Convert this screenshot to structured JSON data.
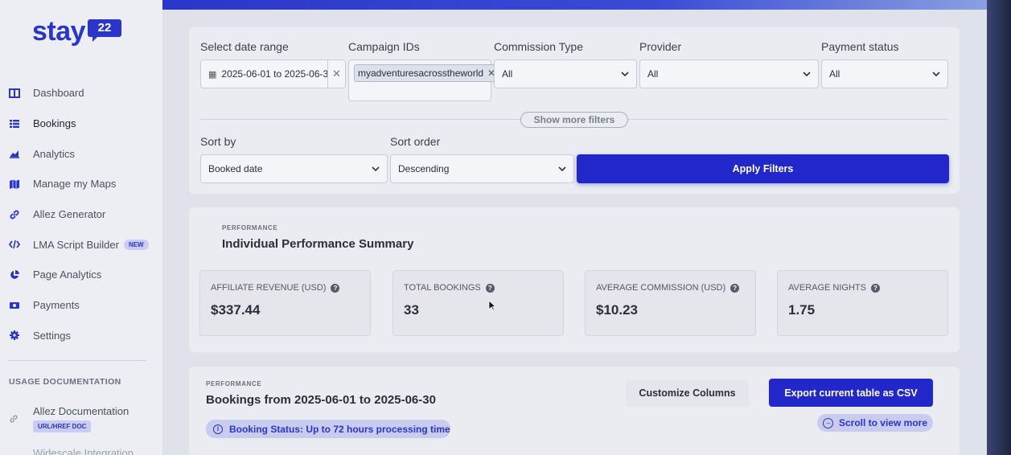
{
  "brand": {
    "logo_text": "stay",
    "logo_badge": "22",
    "accent": "#2a36c9"
  },
  "sidebar": {
    "items": [
      {
        "label": "Dashboard",
        "icon": "dashboard-icon"
      },
      {
        "label": "Bookings",
        "icon": "list-icon"
      },
      {
        "label": "Analytics",
        "icon": "chart-icon"
      },
      {
        "label": "Manage my Maps",
        "icon": "map-icon"
      },
      {
        "label": "Allez Generator",
        "icon": "link-icon"
      },
      {
        "label": "LMA Script Builder",
        "icon": "code-icon",
        "badge": "NEW"
      },
      {
        "label": "Page Analytics",
        "icon": "pie-icon"
      },
      {
        "label": "Payments",
        "icon": "money-icon"
      },
      {
        "label": "Settings",
        "icon": "gear-icon"
      }
    ],
    "doc_heading": "USAGE DOCUMENTATION",
    "doc_items": [
      {
        "title": "Allez Documentation",
        "badge": "URL/HREF DOC"
      }
    ],
    "doc_cut_off": "Widescale Integration"
  },
  "filters": {
    "date_range": {
      "label": "Select date range",
      "value": "2025-06-01 to 2025-06-3"
    },
    "campaign_ids": {
      "label": "Campaign IDs",
      "tag": "myadventuresacrosstheworld"
    },
    "commission_type": {
      "label": "Commission Type",
      "value": "All"
    },
    "provider": {
      "label": "Provider",
      "value": "All"
    },
    "payment_status": {
      "label": "Payment status",
      "value": "All"
    },
    "show_more": "Show more filters",
    "sort_by": {
      "label": "Sort by",
      "value": "Booked date"
    },
    "sort_order": {
      "label": "Sort order",
      "value": "Descending"
    },
    "apply": "Apply Filters"
  },
  "summary": {
    "kicker": "PERFORMANCE",
    "title": "Individual Performance Summary",
    "stats": [
      {
        "label": "AFFILIATE REVENUE (USD)",
        "value": "$337.44"
      },
      {
        "label": "TOTAL BOOKINGS",
        "value": "33"
      },
      {
        "label": "AVERAGE COMMISSION (USD)",
        "value": "$10.23"
      },
      {
        "label": "AVERAGE NIGHTS",
        "value": "1.75"
      }
    ]
  },
  "bookings": {
    "kicker": "PERFORMANCE",
    "title": "Bookings from 2025-06-01 to 2025-06-30",
    "customize": "Customize Columns",
    "export": "Export current table as CSV",
    "scroll_hint": "Scroll to view more",
    "status": "Booking Status: Up to 72 hours processing time"
  }
}
